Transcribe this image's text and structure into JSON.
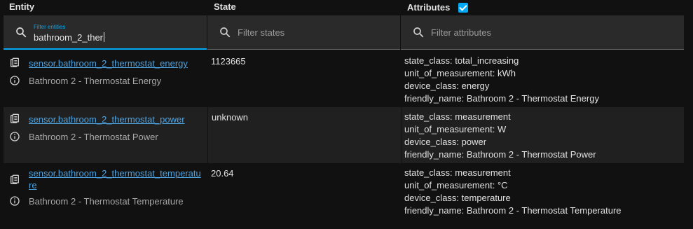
{
  "headers": {
    "entity": "Entity",
    "state": "State",
    "attributes": "Attributes",
    "attributes_checked": true
  },
  "filters": {
    "entities": {
      "label": "Filter entities",
      "value": "bathroom_2_ther"
    },
    "states": {
      "placeholder": "Filter states"
    },
    "attributes": {
      "placeholder": "Filter attributes"
    }
  },
  "rows": [
    {
      "entity_id": "sensor.bathroom_2_thermostat_energy",
      "friendly_name": "Bathroom 2 - Thermostat Energy",
      "state": "1123665",
      "attributes": [
        "state_class: total_increasing",
        "unit_of_measurement: kWh",
        "device_class: energy",
        "friendly_name: Bathroom 2 - Thermostat Energy"
      ]
    },
    {
      "entity_id": "sensor.bathroom_2_thermostat_power",
      "friendly_name": "Bathroom 2 - Thermostat Power",
      "state": "unknown",
      "attributes": [
        "state_class: measurement",
        "unit_of_measurement: W",
        "device_class: power",
        "friendly_name: Bathroom 2 - Thermostat Power"
      ]
    },
    {
      "entity_id": "sensor.bathroom_2_thermostat_temperature",
      "friendly_name": "Bathroom 2 - Thermostat Temperature",
      "state": "20.64",
      "attributes": [
        "state_class: measurement",
        "unit_of_measurement: °C",
        "device_class: temperature",
        "friendly_name: Bathroom 2 - Thermostat Temperature"
      ]
    }
  ],
  "colors": {
    "accent": "#03a9f4",
    "link": "#4fa3e0",
    "background": "#111111",
    "alt_row": "#202020"
  }
}
